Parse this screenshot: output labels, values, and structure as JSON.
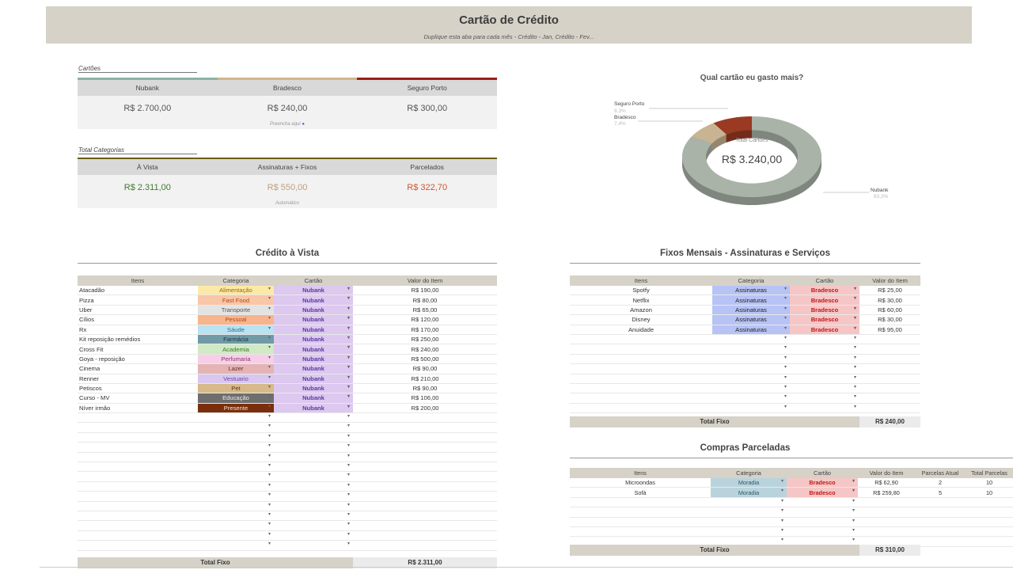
{
  "header": {
    "title": "Cartão de Crédito",
    "subtitle": "Duplique esta aba para cada mês - Crédito - Jan, Crédito - Fev..."
  },
  "cartoes": {
    "label": "Cartões",
    "cards": [
      {
        "name": "Nubank",
        "value": "R$ 2.700,00",
        "color": "#8db3a4"
      },
      {
        "name": "Bradesco",
        "value": "R$ 240,00",
        "color": "#d2b48c"
      },
      {
        "name": "Seguro Porto",
        "value": "R$ 300,00",
        "color": "#9c1c1c"
      }
    ],
    "note": "Preencha aqui"
  },
  "categorias": {
    "label": "Total Categorias",
    "cols": [
      {
        "name": "À Vista",
        "value": "R$ 2.311,00",
        "color": "#3e7a2e"
      },
      {
        "name": "Assinaturas + Fixos",
        "value": "R$ 550,00",
        "color": "#c0a07a"
      },
      {
        "name": "Parcelados",
        "value": "R$ 322,70",
        "color": "#d2552a"
      }
    ],
    "note": "Automático"
  },
  "chart": {
    "title": "Qual cartão eu gasto mais?",
    "center_label": "Total Cartões",
    "center_value": "R$ 3.240,00",
    "labels": [
      {
        "name": "Seguro Porto",
        "pct": "9,3%"
      },
      {
        "name": "Bradesco",
        "pct": "7,4%"
      },
      {
        "name": "Nubank",
        "pct": "83,3%"
      }
    ]
  },
  "chart_data": {
    "type": "pie",
    "title": "Qual cartão eu gasto mais?",
    "categories": [
      "Nubank",
      "Bradesco",
      "Seguro Porto"
    ],
    "values": [
      2700,
      240,
      300
    ],
    "colors": [
      "#a9b3a8",
      "#c8b493",
      "#9a3a22"
    ]
  },
  "vista": {
    "title": "Crédito à Vista",
    "headers": [
      "Itens",
      "Categoria",
      "Cartão",
      "Valor do Item"
    ],
    "rows": [
      {
        "item": "Atacadão",
        "cat": "Alimentação",
        "catbg": "#fde9a6",
        "catfg": "#9a6b00",
        "card": "Nubank",
        "val": "R$ 190,00"
      },
      {
        "item": "Pizza",
        "cat": "Fast Food",
        "catbg": "#f9c6a8",
        "catfg": "#b04a1a",
        "card": "Nubank",
        "val": "R$ 80,00"
      },
      {
        "item": "Uber",
        "cat": "Transporte",
        "catbg": "#e3e3e3",
        "catfg": "#555555",
        "card": "Nubank",
        "val": "R$ 65,00"
      },
      {
        "item": "Cílios",
        "cat": "Pessoal",
        "catbg": "#f7b58d",
        "catfg": "#b5481a",
        "card": "Nubank",
        "val": "R$ 120,00"
      },
      {
        "item": "Rx",
        "cat": "Sáude",
        "catbg": "#b9e2f2",
        "catfg": "#2a6f96",
        "card": "Nubank",
        "val": "R$ 170,00"
      },
      {
        "item": "Kit reposição remédios",
        "cat": "Farmácia",
        "catbg": "#6f9aa6",
        "catfg": "#1e3a44",
        "card": "Nubank",
        "val": "R$ 250,00"
      },
      {
        "item": "Cross Fit",
        "cat": "Academia",
        "catbg": "#cfeac4",
        "catfg": "#3d7a2a",
        "card": "Nubank",
        "val": "R$ 240,00"
      },
      {
        "item": "Goya - reposição",
        "cat": "Perfumaria",
        "catbg": "#f6cfe6",
        "catfg": "#8a3a70",
        "card": "Nubank",
        "val": "R$ 500,00"
      },
      {
        "item": "Cinema",
        "cat": "Lazer",
        "catbg": "#e4b3b3",
        "catfg": "#6a2a2a",
        "card": "Nubank",
        "val": "R$ 90,00"
      },
      {
        "item": "Renner",
        "cat": "Vestuario",
        "catbg": "#d9c7f0",
        "catfg": "#6a4aa0",
        "card": "Nubank",
        "val": "R$ 210,00"
      },
      {
        "item": "Petiscos",
        "cat": "Pet",
        "catbg": "#d7b98a",
        "catfg": "#5a3a10",
        "card": "Nubank",
        "val": "R$ 90,00"
      },
      {
        "item": "Curso - MV",
        "cat": "Educação",
        "catbg": "#6e6e6e",
        "catfg": "#eeeeee",
        "card": "Nubank",
        "val": "R$ 106,00"
      },
      {
        "item": "Níver irmão",
        "cat": "Presente",
        "catbg": "#7a2e0c",
        "catfg": "#fbe3d0",
        "card": "Nubank",
        "val": "R$ 200,00"
      }
    ],
    "empty_rows": 14,
    "total_label": "Total Fixo",
    "total_value": "R$ 2.311,00"
  },
  "fixos": {
    "title": "Fixos Mensais - Assinaturas e Serviços",
    "headers": [
      "Itens",
      "Categoria",
      "Cartão",
      "Valor do Item"
    ],
    "rows": [
      {
        "item": "Spotfy",
        "cat": "Assinaturas",
        "card": "Bradesco",
        "val": "R$ 25,00"
      },
      {
        "item": "Netflix",
        "cat": "Assinaturas",
        "card": "Bradesco",
        "val": "R$ 30,00"
      },
      {
        "item": "Amazon",
        "cat": "Assinaturas",
        "card": "Bradesco",
        "val": "R$ 60,00"
      },
      {
        "item": "Disney",
        "cat": "Assinaturas",
        "card": "Bradesco",
        "val": "R$ 30,00"
      },
      {
        "item": "Anuidade",
        "cat": "Assinaturas",
        "card": "Bradesco",
        "val": "R$ 95,00"
      }
    ],
    "empty_rows": 8,
    "total_label": "Total Fixo",
    "total_value": "R$ 240,00"
  },
  "parceladas": {
    "title": "Compras Parceladas",
    "headers": [
      "Itens",
      "Categoria",
      "Cartão",
      "Valor do Item",
      "Parcelas Atual",
      "Total Parcelas"
    ],
    "rows": [
      {
        "item": "Microondas",
        "cat": "Moradia",
        "card": "Bradesco",
        "val": "R$ 62,90",
        "atual": "2",
        "total": "10"
      },
      {
        "item": "Sofá",
        "cat": "Moradia",
        "card": "Bradesco",
        "val": "R$ 259,80",
        "atual": "5",
        "total": "10"
      }
    ],
    "empty_rows": 5,
    "total_label": "Total Fixo",
    "total_value": "R$ 310,00"
  }
}
